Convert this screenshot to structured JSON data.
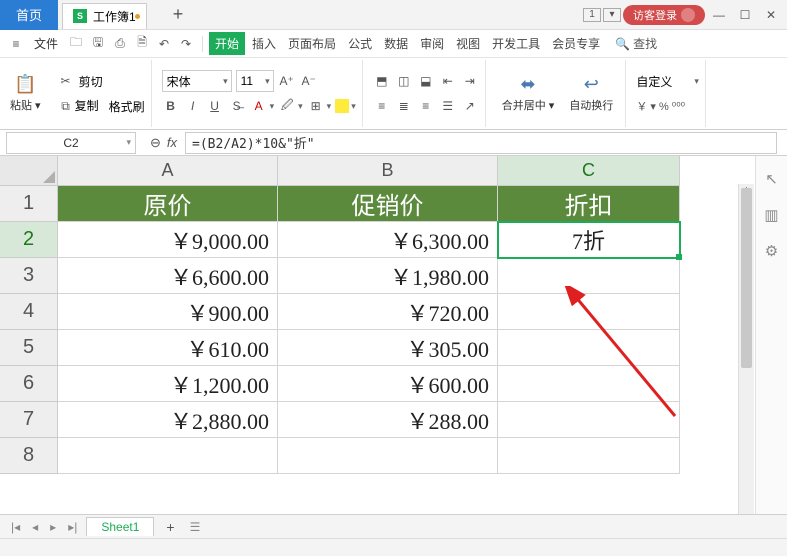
{
  "titlebar": {
    "home_tab": "首页",
    "doc_tab": "工作簿1",
    "doc_icon_letter": "S",
    "window_indicator": "1",
    "login": "访客登录"
  },
  "menubar": {
    "file_label": "文件",
    "items": [
      "开始",
      "插入",
      "页面布局",
      "公式",
      "数据",
      "审阅",
      "视图",
      "开发工具",
      "会员专享"
    ],
    "active_index": 0,
    "search_label": "查找"
  },
  "ribbon": {
    "paste_label": "粘贴",
    "cut_label": "剪切",
    "copy_label": "复制",
    "format_painter_label": "格式刷",
    "font_name": "宋体",
    "font_size": "11",
    "merge_label": "合并居中",
    "wrap_label": "自动换行",
    "custom_label": "自定义",
    "currency_symbols": "￥ ▾ % ⁰⁰⁰"
  },
  "formula_bar": {
    "name_box": "C2",
    "fx_label": "fx",
    "formula": "=(B2/A2)*10&\"折\""
  },
  "sheet": {
    "columns": [
      "A",
      "B",
      "C"
    ],
    "selected_col_index": 2,
    "selected_row": 2,
    "headers": [
      "原价",
      "促销价",
      "折扣"
    ],
    "rows": [
      {
        "a": "￥9,000.00",
        "b": "￥6,300.00",
        "c": "7折"
      },
      {
        "a": "￥6,600.00",
        "b": "￥1,980.00",
        "c": ""
      },
      {
        "a": "￥900.00",
        "b": "￥720.00",
        "c": ""
      },
      {
        "a": "￥610.00",
        "b": "￥305.00",
        "c": ""
      },
      {
        "a": "￥1,200.00",
        "b": "￥600.00",
        "c": ""
      },
      {
        "a": "￥2,880.00",
        "b": "￥288.00",
        "c": ""
      }
    ],
    "tab_name": "Sheet1"
  }
}
